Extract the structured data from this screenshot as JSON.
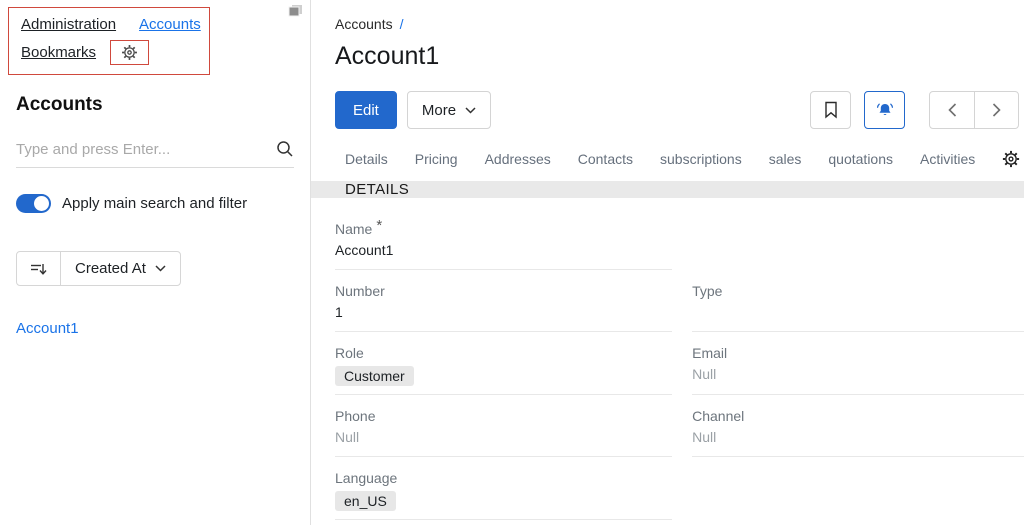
{
  "sidebar": {
    "nav": {
      "administration": "Administration",
      "accounts": "Accounts",
      "bookmarks": "Bookmarks"
    },
    "heading": "Accounts",
    "search": {
      "placeholder": "Type and press Enter..."
    },
    "filter_toggle": {
      "label": "Apply main search and filter",
      "state": "on"
    },
    "sort": {
      "selected": "Created At"
    },
    "records": {
      "first": "Account1"
    }
  },
  "main": {
    "breadcrumb": {
      "parent": "Accounts",
      "separator": "/"
    },
    "title": "Account1",
    "toolbar": {
      "edit": "Edit",
      "more": "More"
    },
    "tabs": [
      "Details",
      "Pricing",
      "Addresses",
      "Contacts",
      "subscriptions",
      "sales",
      "quotations",
      "Activities"
    ],
    "section_header": "DETAILS",
    "fields": {
      "name": {
        "label": "Name",
        "required_marker": "*",
        "value": "Account1"
      },
      "number": {
        "label": "Number",
        "value": "1"
      },
      "type": {
        "label": "Type",
        "value": ""
      },
      "role": {
        "label": "Role",
        "value": "Customer"
      },
      "email": {
        "label": "Email",
        "value": "Null"
      },
      "phone": {
        "label": "Phone",
        "value": "Null"
      },
      "channel": {
        "label": "Channel",
        "value": "Null"
      },
      "language": {
        "label": "Language",
        "value": "en_US"
      }
    }
  },
  "colors": {
    "primary_blue": "#2268cc",
    "link_blue": "#1a73e8",
    "annotation_red": "#d0493d",
    "section_bar_bg": "#e9e9e9",
    "badge_bg": "#e7e7e7",
    "null_text": "#9ba1a6"
  }
}
